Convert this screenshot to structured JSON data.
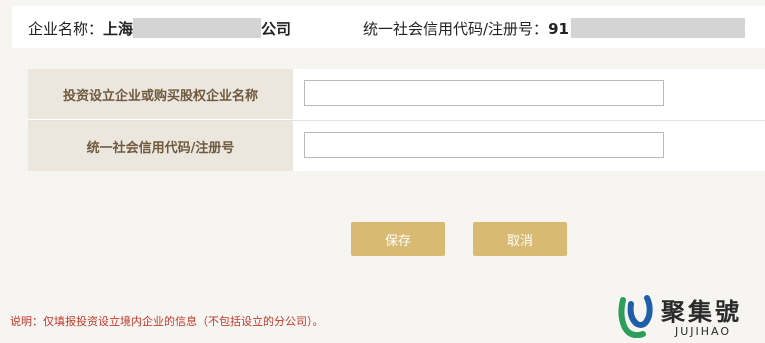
{
  "header": {
    "company_label": "企业名称：",
    "company_prefix": "上海",
    "company_suffix": "公司",
    "credit_label": "统一社会信用代码/注册号：",
    "credit_prefix": "91"
  },
  "form": {
    "rows": [
      {
        "label": "投资设立企业或购买股权企业名称",
        "value": "",
        "placeholder": ""
      },
      {
        "label": "统一社会信用代码/注册号",
        "value": "",
        "placeholder": ""
      }
    ]
  },
  "actions": {
    "save_label": "保存",
    "cancel_label": "取消"
  },
  "note": "说明：仅填报投资设立境内企业的信息（不包括设立的分公司）。",
  "watermark": {
    "cn": "聚集號",
    "en": "JUJIHAO"
  },
  "colors": {
    "accent_button": "#d8ba72",
    "label_background": "#ebe7df",
    "label_text": "#6f5a3e",
    "note_text": "#c0392b",
    "logo_green": "#2e9e5a",
    "logo_blue": "#1f5fa8"
  }
}
